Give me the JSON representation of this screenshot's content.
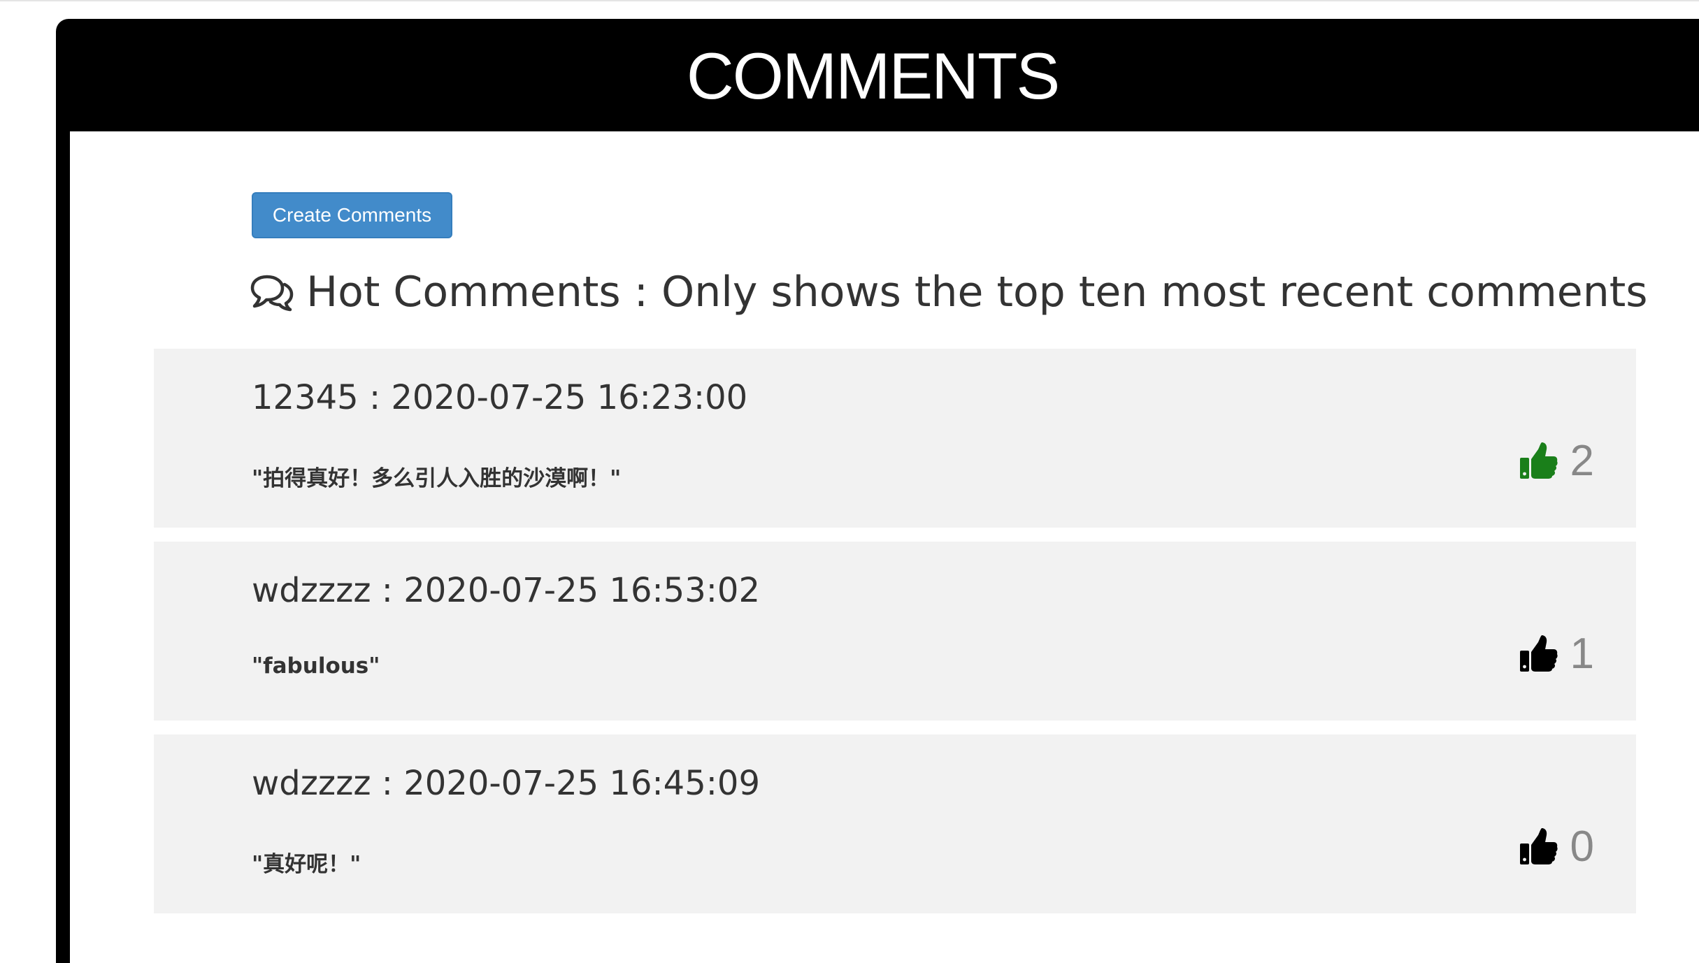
{
  "header": {
    "title": "COMMENTS"
  },
  "toolbar": {
    "create_label": "Create Comments"
  },
  "hot": {
    "heading": "Hot Comments : Only shows the top ten most recent comments",
    "icon": "comments-icon"
  },
  "comments": [
    {
      "author_line": "12345 : 2020-07-25 16:23:00",
      "text": "\"拍得真好！多么引人入胜的沙漠啊！\"",
      "likes": "2",
      "liked": true,
      "like_color": "#1a7f1a"
    },
    {
      "author_line": "wdzzzz : 2020-07-25 16:53:02",
      "text": "\"fabulous\"",
      "likes": "1",
      "liked": false,
      "like_color": "#000000"
    },
    {
      "author_line": "wdzzzz : 2020-07-25 16:45:09",
      "text": "\"真好呢！\"",
      "likes": "0",
      "liked": false,
      "like_color": "#000000"
    }
  ],
  "colors": {
    "header_bg": "#000000",
    "button_bg": "#428bca",
    "card_bg": "#f2f2f2",
    "liked": "#1a7f1a"
  }
}
